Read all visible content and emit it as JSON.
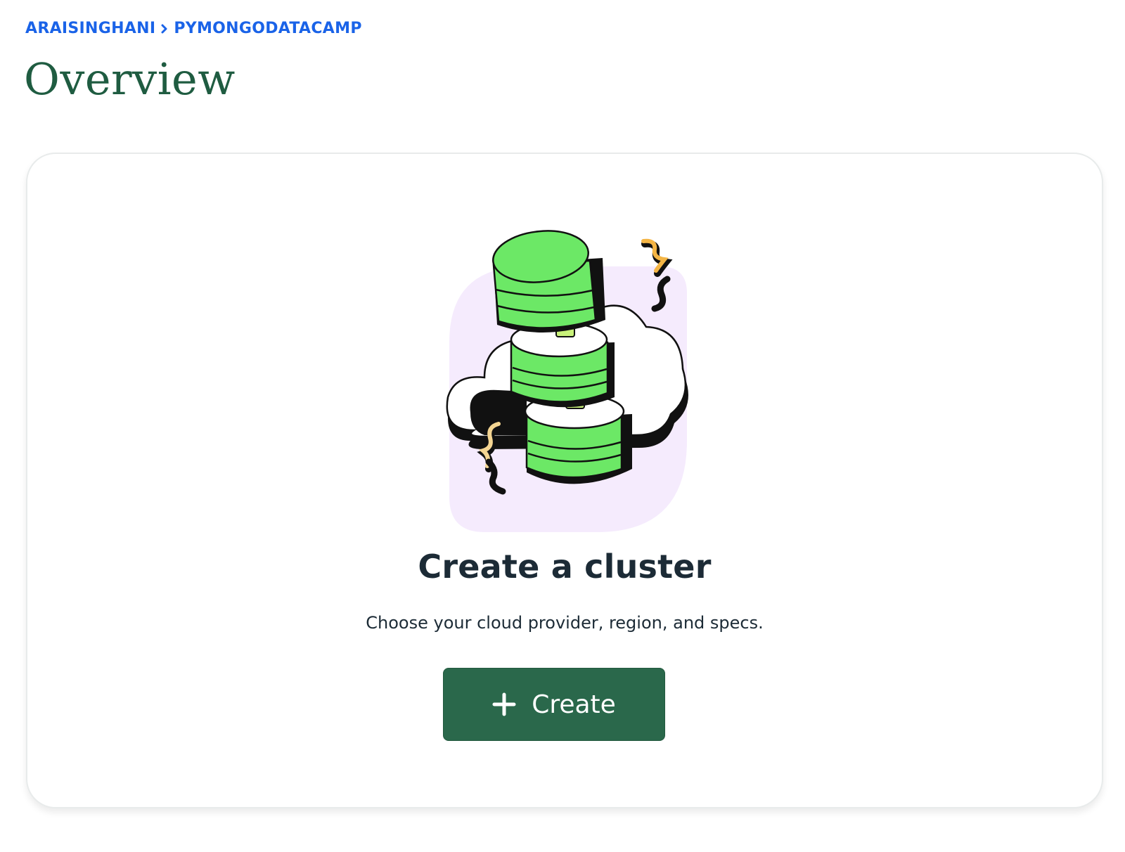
{
  "breadcrumb": {
    "items": [
      "ARAISINGHANI",
      "PYMONGODATACAMP"
    ],
    "separator_icon": "chevron-right-icon"
  },
  "page": {
    "title": "Overview"
  },
  "empty_state": {
    "illustration": "database-cluster-cloud-illustration",
    "heading": "Create a cluster",
    "description": "Choose your cloud provider, region, and specs.",
    "button_label": "Create",
    "button_icon": "plus-icon"
  },
  "colors": {
    "link": "#1a63e8",
    "title": "#1f5c41",
    "button_bg": "#2a684b",
    "text": "#1c2b36",
    "cluster_green": "#6ce866",
    "cloud_lavender": "#f5ebfd",
    "brace_orange": "#f4b545"
  }
}
